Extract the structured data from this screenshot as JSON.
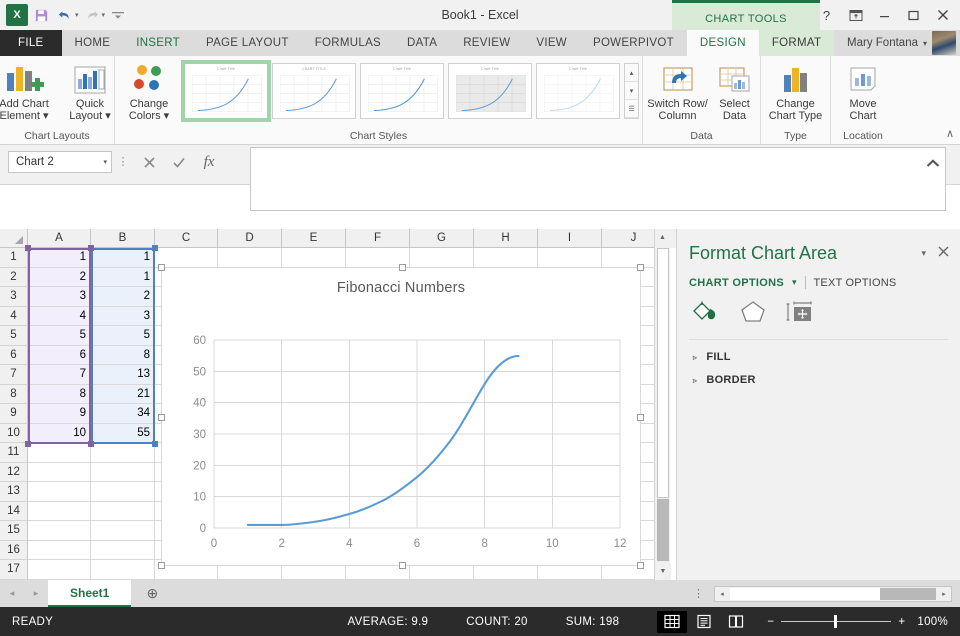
{
  "titlebar": {
    "document_title": "Book1 - Excel",
    "qat": [
      {
        "name": "excel-logo",
        "label": "X"
      },
      {
        "name": "save-icon",
        "label": "ὋE"
      },
      {
        "name": "undo-icon",
        "label": "↶"
      },
      {
        "name": "redo-icon",
        "label": "↷"
      },
      {
        "name": "customize-qat-icon",
        "label": "☰"
      }
    ],
    "context_tab_label": "CHART TOOLS",
    "window_buttons": {
      "help": "?",
      "ribbon_display": "⤒",
      "minimize": "–",
      "restore": "❐",
      "close": "✕"
    }
  },
  "tabs": [
    {
      "label": "FILE",
      "state": "file"
    },
    {
      "label": "HOME",
      "state": "normal"
    },
    {
      "label": "INSERT",
      "state": "highlight"
    },
    {
      "label": "PAGE LAYOUT",
      "state": "normal"
    },
    {
      "label": "FORMULAS",
      "state": "normal"
    },
    {
      "label": "DATA",
      "state": "normal"
    },
    {
      "label": "REVIEW",
      "state": "normal"
    },
    {
      "label": "VIEW",
      "state": "normal"
    },
    {
      "label": "POWERPIVOT",
      "state": "normal"
    },
    {
      "label": "DESIGN",
      "state": "active-context"
    },
    {
      "label": "FORMAT",
      "state": "context"
    }
  ],
  "account": {
    "user_name": "Mary Fontana",
    "dropdown_caret": "▾"
  },
  "ribbon": {
    "groups": [
      {
        "name": "chart-layouts",
        "label": "Chart Layouts",
        "buttons": [
          {
            "name": "add-chart-element",
            "line1": "Add Chart",
            "line2": "Element ▾"
          },
          {
            "name": "quick-layout",
            "line1": "Quick",
            "line2": "Layout ▾"
          }
        ]
      },
      {
        "name": "chart-styles",
        "label": "Chart Styles",
        "buttons": [
          {
            "name": "change-colors",
            "line1": "Change",
            "line2": "Colors ▾"
          }
        ],
        "thumbnails": [
          {
            "title": "Chart Title",
            "selected": true
          },
          {
            "title": "CHART TITLE",
            "selected": false
          },
          {
            "title": "Chart Title",
            "selected": false
          },
          {
            "title": "Chart Title",
            "selected": false
          },
          {
            "title": "Chart Title",
            "selected": false
          }
        ],
        "scroll_buttons": [
          "▴",
          "▾",
          "☰"
        ]
      },
      {
        "name": "data",
        "label": "Data",
        "buttons": [
          {
            "name": "switch-row-column",
            "line1": "Switch Row/",
            "line2": "Column"
          },
          {
            "name": "select-data",
            "line1": "Select",
            "line2": "Data"
          }
        ]
      },
      {
        "name": "type",
        "label": "Type",
        "buttons": [
          {
            "name": "change-chart-type",
            "line1": "Change",
            "line2": "Chart Type"
          }
        ]
      },
      {
        "name": "location",
        "label": "Location",
        "buttons": [
          {
            "name": "move-chart",
            "line1": "Move",
            "line2": "Chart"
          }
        ]
      }
    ],
    "collapse_icon": "∧"
  },
  "formula_bar": {
    "name_box_value": "Chart 2",
    "name_box_caret": "▾",
    "cancel_icon": "✕",
    "enter_icon": "✓",
    "function_icon": "ƒx",
    "formula_value": "",
    "expand_icon": "∧"
  },
  "grid": {
    "columns": [
      "A",
      "B",
      "C",
      "D",
      "E",
      "F",
      "G",
      "H",
      "I",
      "J"
    ],
    "rows": [
      "1",
      "2",
      "3",
      "4",
      "5",
      "6",
      "7",
      "8",
      "9",
      "10",
      "11",
      "12",
      "13",
      "14",
      "15",
      "16",
      "17"
    ],
    "data": [
      [
        "1",
        "1"
      ],
      [
        "2",
        "1"
      ],
      [
        "3",
        "2"
      ],
      [
        "4",
        "3"
      ],
      [
        "5",
        "5"
      ],
      [
        "6",
        "8"
      ],
      [
        "7",
        "13"
      ],
      [
        "8",
        "21"
      ],
      [
        "9",
        "34"
      ],
      [
        "10",
        "55"
      ]
    ],
    "selection_colors": {
      "series_x": "#8064a2",
      "series_y": "#4f81bd"
    }
  },
  "chart_data": {
    "type": "line",
    "title": "Fibonacci Numbers",
    "xlabel": "",
    "ylabel": "",
    "x": [
      1,
      2,
      3,
      4,
      5,
      6,
      7,
      8,
      9,
      10
    ],
    "values": [
      1,
      1,
      2,
      3,
      5,
      8,
      13,
      21,
      34,
      55
    ],
    "series": [
      {
        "name": "Fibonacci Numbers",
        "values": [
          1,
          1,
          2,
          3,
          5,
          8,
          13,
          21,
          34,
          55
        ],
        "color": "#5b9bd5"
      }
    ],
    "xlim": [
      0,
      12
    ],
    "ylim": [
      0,
      60
    ],
    "xticks": [
      "0",
      "2",
      "4",
      "6",
      "8",
      "10",
      "12"
    ],
    "yticks": [
      "0",
      "10",
      "20",
      "30",
      "40",
      "50",
      "60"
    ],
    "grid": true,
    "legend": "none",
    "smooth": true
  },
  "task_pane": {
    "title": "Format Chart Area",
    "menu_icon": "▾",
    "close_icon": "✕",
    "tabs": [
      {
        "name": "chart-options",
        "label": "CHART OPTIONS",
        "caret": "▾",
        "active": true
      },
      {
        "name": "text-options",
        "label": "TEXT OPTIONS",
        "active": false
      }
    ],
    "icons": [
      {
        "name": "fill-and-line-icon"
      },
      {
        "name": "effects-icon"
      },
      {
        "name": "size-and-properties-icon"
      }
    ],
    "sections": [
      {
        "name": "fill",
        "label": "FILL",
        "expander": "▹"
      },
      {
        "name": "border",
        "label": "BORDER",
        "expander": "▹"
      }
    ]
  },
  "sheet_tabs": {
    "prev_icon": "◂",
    "next_icon": "▸",
    "tabs": [
      {
        "label": "Sheet1",
        "active": true
      }
    ],
    "new_sheet_icon": "⊕",
    "options_icon": "⋮",
    "hscroll_left": "◂",
    "hscroll_right": "▸"
  },
  "status_bar": {
    "mode": "READY",
    "average": "AVERAGE: 9.9",
    "count": "COUNT: 20",
    "sum": "SUM: 198",
    "views": [
      {
        "name": "normal-view-button",
        "icon": "▦",
        "active": true
      },
      {
        "name": "page-layout-view-button",
        "icon": "▤",
        "active": false
      },
      {
        "name": "page-break-preview-button",
        "icon": "▥",
        "active": false
      }
    ],
    "zoom_out_icon": "−",
    "zoom_in_icon": "+",
    "zoom_level": "100%"
  }
}
